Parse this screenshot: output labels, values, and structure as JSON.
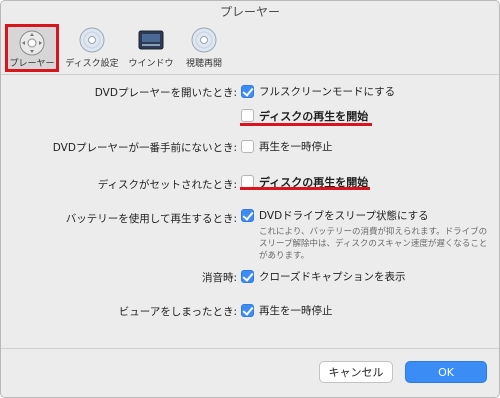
{
  "window": {
    "title": "プレーヤー"
  },
  "toolbar": {
    "items": [
      {
        "label": "プレーヤー",
        "icon": "remote-control-icon",
        "active": true
      },
      {
        "label": "ディスク設定",
        "icon": "disc-icon",
        "active": false
      },
      {
        "label": "ウインドウ",
        "icon": "window-icon",
        "active": false
      },
      {
        "label": "視聴再開",
        "icon": "disc-resume-icon",
        "active": false
      }
    ]
  },
  "settings": {
    "rows": [
      {
        "label": "DVDプレーヤーを開いたとき:",
        "option": "フルスクリーンモードにする",
        "checked": true
      },
      {
        "label": "",
        "option": "ディスクの再生を開始",
        "checked": false,
        "emphasized": true
      },
      {
        "label": "DVDプレーヤーが一番手前にないとき:",
        "option": "再生を一時停止",
        "checked": false
      },
      {
        "label": "ディスクがセットされたとき:",
        "option": "ディスクの再生を開始",
        "checked": false,
        "emphasized": true
      },
      {
        "label": "バッテリーを使用して再生するとき:",
        "option": "DVDドライブをスリープ状態にする",
        "checked": true
      },
      {
        "label": "消音時:",
        "option": "クローズドキャプションを表示",
        "checked": true
      },
      {
        "label": "ビューアをしまったとき:",
        "option": "再生を一時停止",
        "checked": true
      }
    ],
    "battery_note": "これにより、バッテリーの消費が抑えられます。ドライブのスリープ解除中は、ディスクのスキャン速度が遅くなることがあります。"
  },
  "buttons": {
    "cancel": "キャンセル",
    "ok": "OK"
  },
  "colors": {
    "accent": "#3b8cf5",
    "highlight": "#d8141c"
  }
}
